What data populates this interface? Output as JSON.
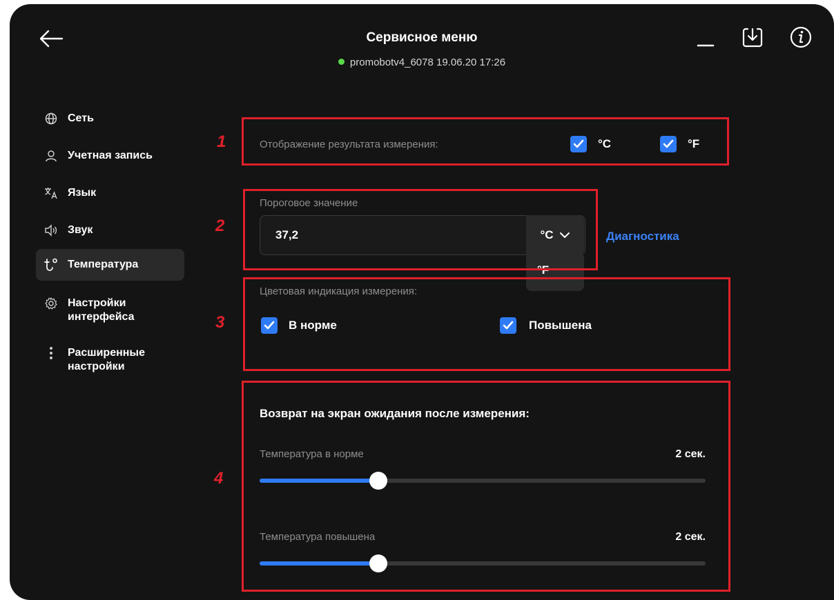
{
  "header": {
    "title": "Сервисное меню",
    "device": "promobotv4_6078 19.06.20  17:26",
    "status_color": "#5ad84a"
  },
  "icons": {
    "back": "arrow-left-icon",
    "minimize": "minimize-icon",
    "download": "download-icon",
    "info": "info-icon"
  },
  "sidebar": {
    "items": [
      {
        "label": "Сеть",
        "icon": "globe-icon"
      },
      {
        "label": "Учетная запись",
        "icon": "user-icon"
      },
      {
        "label": "Язык",
        "icon": "translate-icon"
      },
      {
        "label": "Звук",
        "icon": "speaker-icon"
      },
      {
        "label": "Температура",
        "icon": "thermometer-icon",
        "active": true
      },
      {
        "label": "Настройки\nинтерфейса",
        "icon": "gear-icon"
      },
      {
        "label": "Расширенные\nнастройки",
        "icon": "more-vertical-icon"
      }
    ]
  },
  "annotations": [
    "1",
    "2",
    "3",
    "4"
  ],
  "display_section": {
    "label": "Отображение результата измерения:",
    "options": [
      {
        "label": "°C",
        "checked": true
      },
      {
        "label": "°F",
        "checked": true
      }
    ]
  },
  "threshold": {
    "label": "Пороговое значение",
    "value": "37,2",
    "unit_selected": "°C",
    "unit_options": [
      "°F"
    ],
    "diagnostics_link": "Диагностика"
  },
  "color_indication": {
    "label": "Цветовая индикация измерения:",
    "options": [
      {
        "label": "В норме",
        "checked": true
      },
      {
        "label": "Повышена",
        "checked": true
      }
    ]
  },
  "return_section": {
    "title": "Возврат на экран ожидания после измерения:",
    "sliders": [
      {
        "label": "Температура в норме",
        "value": "2 сек.",
        "fraction": 0.267
      },
      {
        "label": "Температура повышена",
        "value": "2 сек.",
        "fraction": 0.267
      }
    ]
  },
  "colors": {
    "accent": "#2f7bf5",
    "link": "#3b82f6",
    "annotation": "#e0202a",
    "background": "#141414"
  }
}
